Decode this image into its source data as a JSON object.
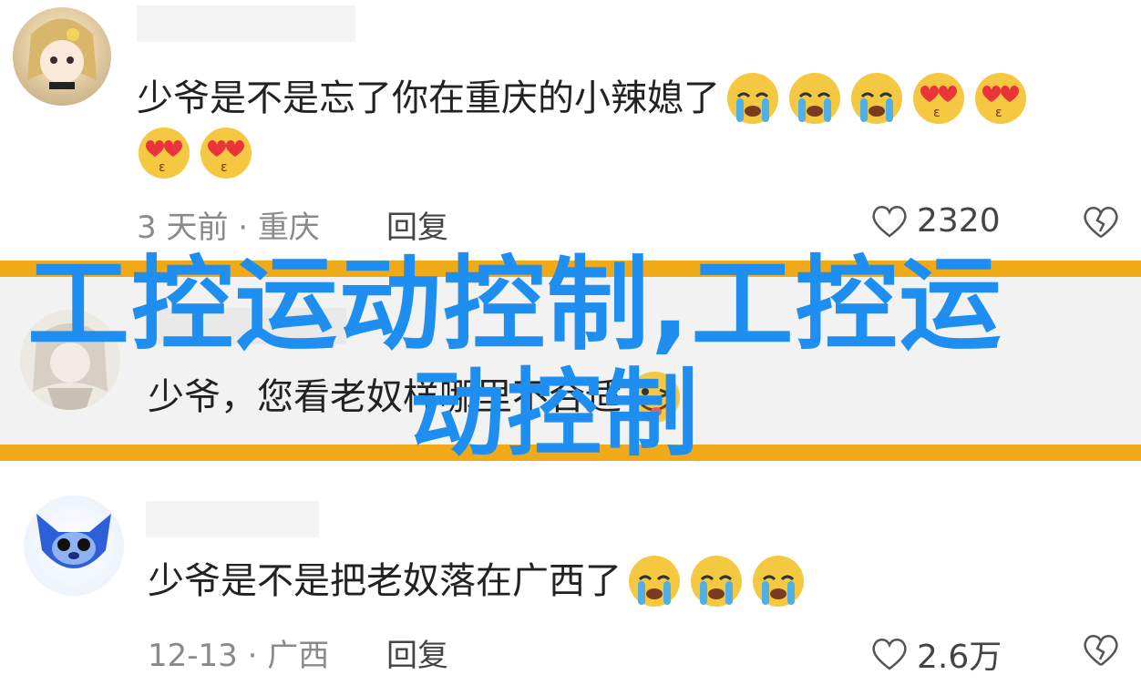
{
  "comments": [
    {
      "text": "少爷是不是忘了你在重庆的小辣媳了",
      "meta": "3 天前 · 重庆",
      "reply": "回复",
      "likes": "2320"
    },
    {
      "text": "少爷，您看老奴样哪里不合适"
    },
    {
      "text": "少爷是不是把老奴落在广西了",
      "meta": "12-13 · 广西",
      "reply": "回复",
      "likes": "2.6万"
    }
  ],
  "overlay": {
    "line1": "工控运动控制,工控运",
    "line2": "动控制"
  },
  "colors": {
    "accent_band": "#f0aa17",
    "overlay_text": "#1e8ff0",
    "meta_gray": "#8a8a8a"
  },
  "icons": [
    "heart-outline-icon",
    "broken-heart-icon",
    "crying-emoji",
    "heart-eyes-emoji",
    "winking-tongue-emoji"
  ]
}
